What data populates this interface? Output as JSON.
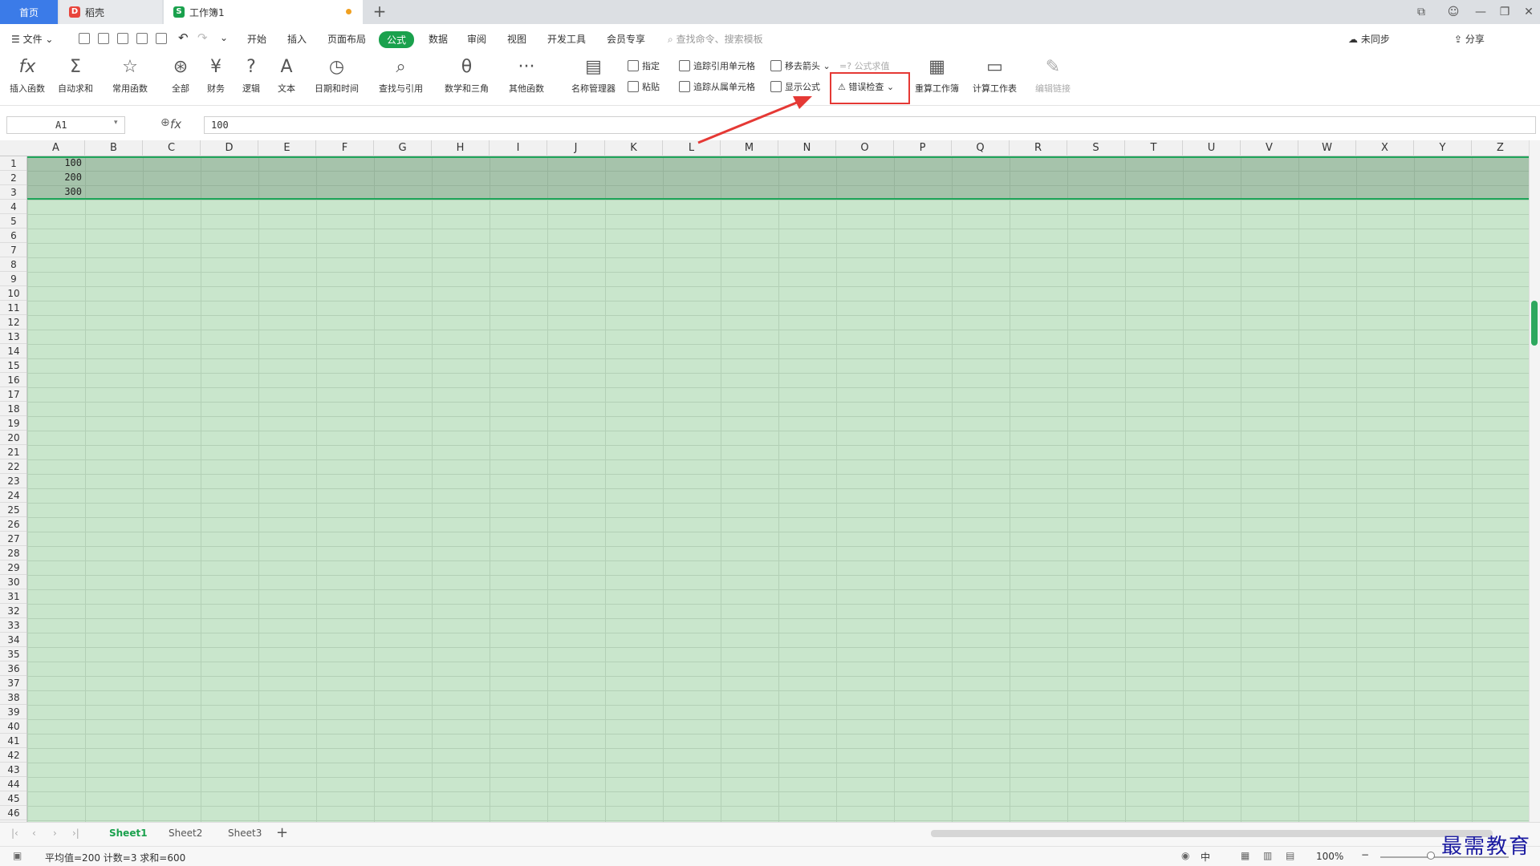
{
  "tabs": {
    "home": "首页",
    "docer": "稻壳",
    "workbook": "工作簿1",
    "add": "+"
  },
  "menu": {
    "file": "文件",
    "items": [
      "开始",
      "插入",
      "页面布局",
      "公式",
      "数据",
      "审阅",
      "视图",
      "开发工具",
      "会员专享"
    ],
    "search_placeholder": "查找命令、搜索模板",
    "cloud": "未同步",
    "share": "分享"
  },
  "ribbon": {
    "insert_func": "插入函数",
    "autosum": "自动求和",
    "common": "常用函数",
    "all": "全部",
    "finance": "财务",
    "logic": "逻辑",
    "text": "文本",
    "datetime": "日期和时间",
    "lookup": "查找与引用",
    "math": "数学和三角",
    "other": "其他函数",
    "name_mgr": "名称管理器",
    "define": "指定",
    "paste": "粘贴",
    "trace_prec": "追踪引用单元格",
    "trace_dep": "追踪从属单元格",
    "remove_arrows": "移去箭头",
    "show_formula": "显示公式",
    "eval_formula": "公式求值",
    "error_check": "错误检查",
    "recalc_book": "重算工作簿",
    "calc_sheet": "计算工作表",
    "edit_links": "编辑链接"
  },
  "formula_bar": {
    "name_box": "A1",
    "fx": "fx",
    "value": "100"
  },
  "grid": {
    "columns": [
      "A",
      "B",
      "C",
      "D",
      "E",
      "F",
      "G",
      "H",
      "I",
      "J",
      "K",
      "L",
      "M",
      "N",
      "O",
      "P",
      "Q",
      "R",
      "S",
      "T",
      "U",
      "V",
      "W",
      "X",
      "Y",
      "Z"
    ],
    "rows": 46,
    "cells": [
      {
        "ref": "A1",
        "value": "100"
      },
      {
        "ref": "A2",
        "value": "200"
      },
      {
        "ref": "A3",
        "value": "300"
      }
    ]
  },
  "sheets": [
    "Sheet1",
    "Sheet2",
    "Sheet3"
  ],
  "status": {
    "summary": "平均值=200  计数=3  求和=600",
    "zoom": "100%",
    "input_mode": "中"
  },
  "watermark": "最需教育",
  "colors": {
    "accent": "#1aa14d",
    "highlight_box": "#e53935",
    "cell_bg": "#c9e6cc",
    "home_tab": "#3b7be8"
  }
}
